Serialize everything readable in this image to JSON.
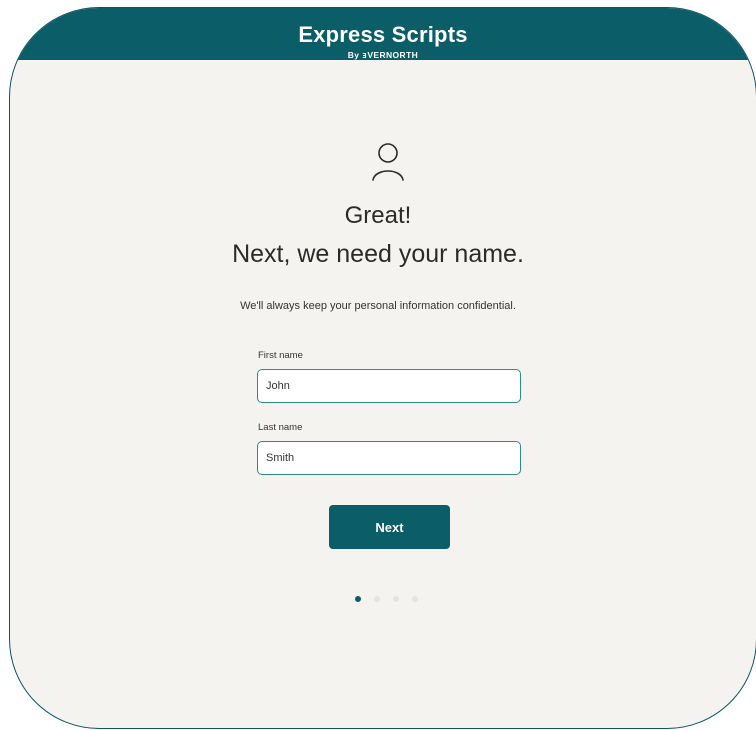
{
  "brand": {
    "title": "Express Scripts",
    "subtitle": "By ⱻVERNORTH"
  },
  "main": {
    "heading_line1": "Great!",
    "heading_line2": "Next, we need your name.",
    "subtext": "We'll always keep your personal information confidential.",
    "icon": "user-icon"
  },
  "form": {
    "first_name": {
      "label": "First name",
      "value": "John"
    },
    "last_name": {
      "label": "Last name",
      "value": "Smith"
    },
    "next_label": "Next"
  },
  "progress": {
    "total_steps": 4,
    "current_step": 1
  },
  "colors": {
    "brand": "#0b5d68",
    "background": "#f4f3f0",
    "input_border": "#2e8b82"
  }
}
